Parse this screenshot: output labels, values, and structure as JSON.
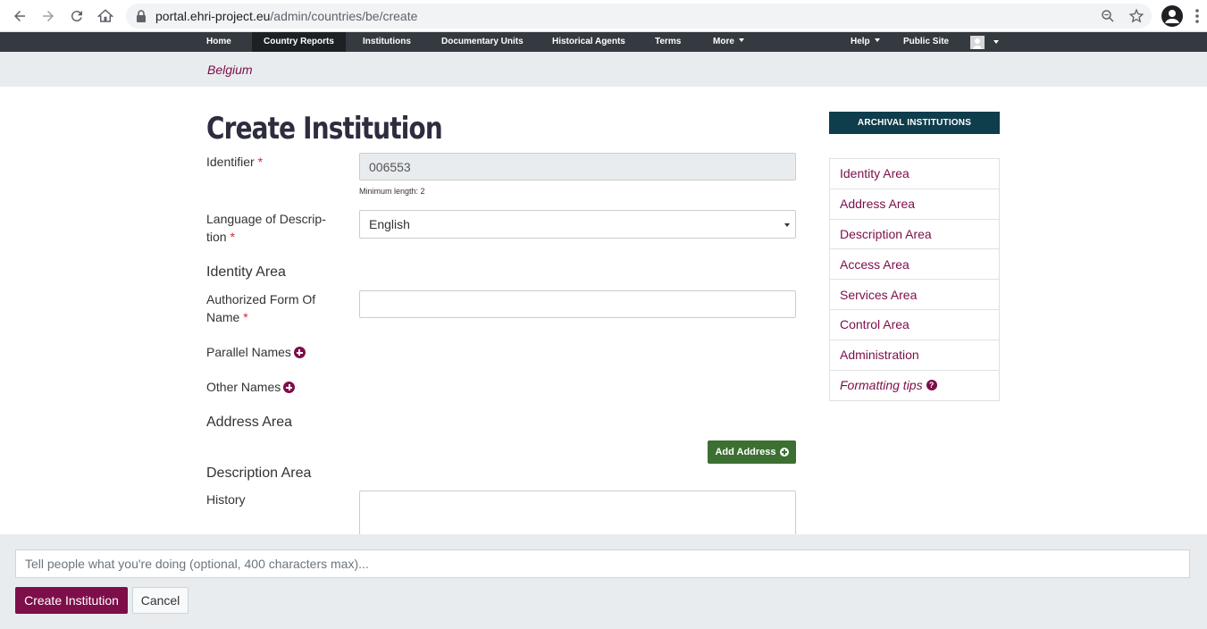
{
  "browser": {
    "url_host": "portal.ehri-project.eu",
    "url_path": "/admin/countries/be/create"
  },
  "nav": {
    "home": "Home",
    "country_reports": "Country Reports",
    "institutions": "Institutions",
    "documentary_units": "Documentary Units",
    "historical_agents": "Historical Agents",
    "terms": "Terms",
    "more": "More",
    "help": "Help",
    "public_site": "Public Site"
  },
  "breadcrumb": "Belgium",
  "form": {
    "title": "Create Institution",
    "identifier_label": "Identifier",
    "identifier_value": "006553",
    "identifier_help": "Minimum length: 2",
    "language_label_1": "Language of Descrip-",
    "language_label_2": "tion",
    "language_value": "English",
    "identity_area": "Identity Area",
    "authorized_label_1": "Authorized Form Of",
    "authorized_label_2": "Name",
    "parallel_names": "Parallel Names",
    "other_names": "Other Names",
    "address_area": "Address Area",
    "add_address": "Add Address",
    "description_area": "Description Area",
    "history_label": "History",
    "required_mark": "*"
  },
  "sidebar": {
    "heading": "ARCHIVAL INSTITUTIONS",
    "items": [
      {
        "label": "Identity Area"
      },
      {
        "label": "Address Area"
      },
      {
        "label": "Description Area"
      },
      {
        "label": "Access Area"
      },
      {
        "label": "Services Area"
      },
      {
        "label": "Control Area"
      },
      {
        "label": "Administration"
      }
    ],
    "formatting_tips": "Formatting tips"
  },
  "bottom": {
    "log_placeholder": "Tell people what you're doing (optional, 400 characters max)...",
    "create_button": "Create Institution",
    "cancel_button": "Cancel"
  },
  "colors": {
    "accent": "#7d0e4a",
    "nav_bg": "#343a40",
    "sidebar_head": "#0f3d4c",
    "add_button": "#3c6f32"
  }
}
